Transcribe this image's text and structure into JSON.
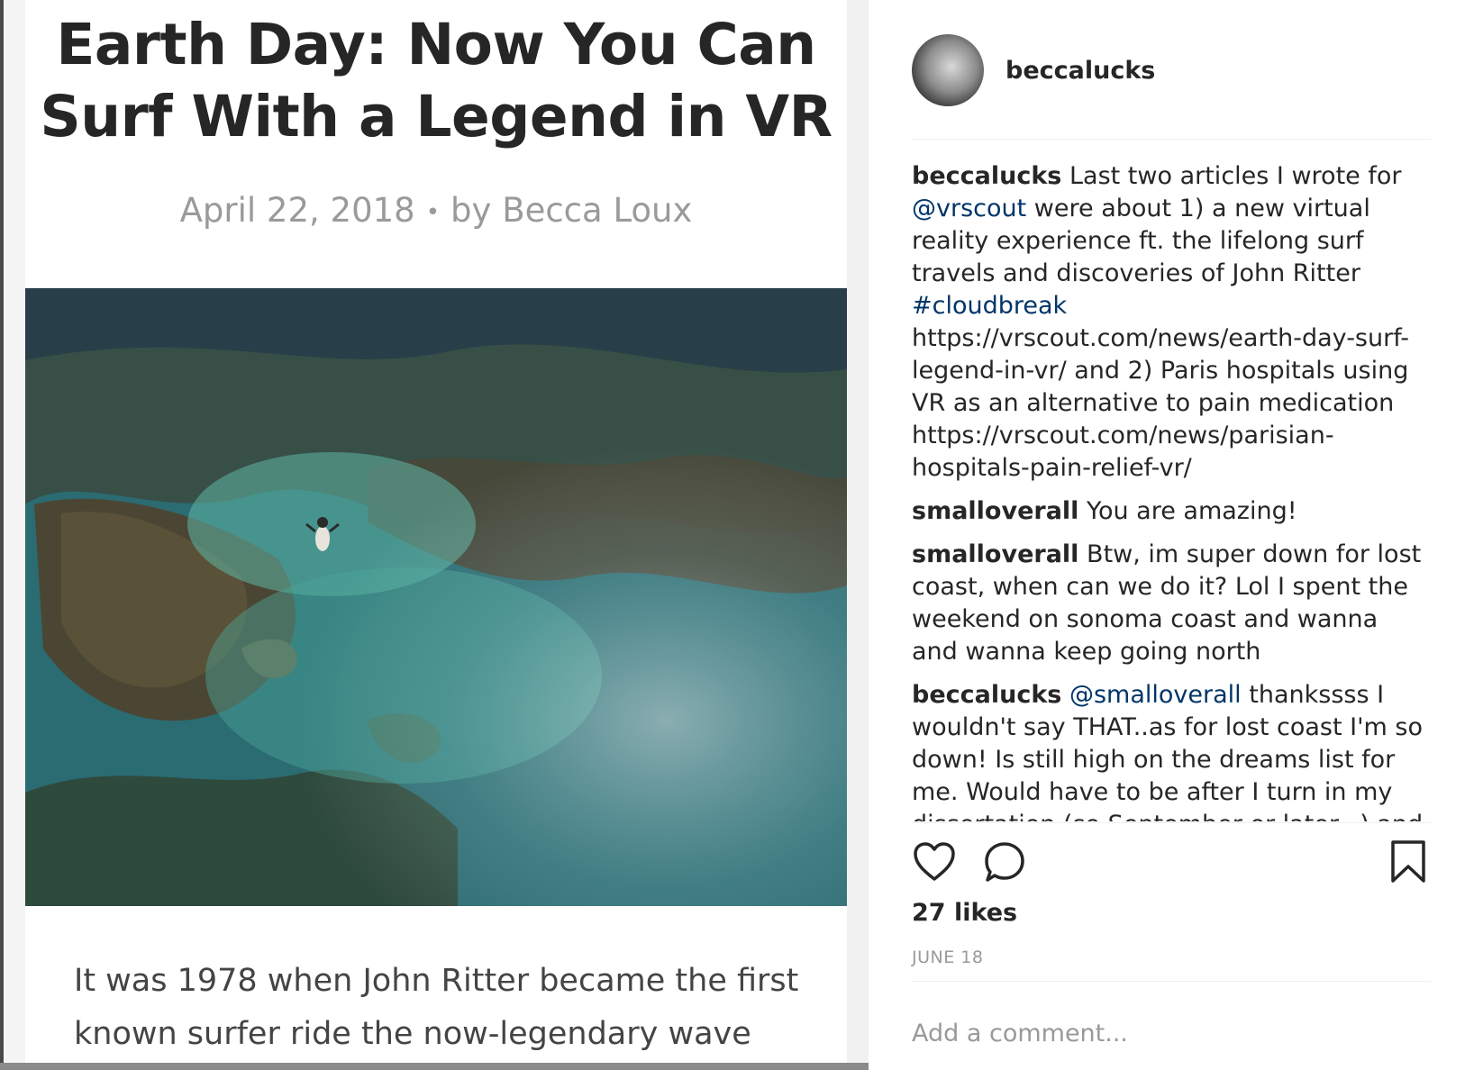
{
  "article": {
    "title": "Earth Day: Now You Can Surf With a Legend in VR",
    "date": "April 22, 2018",
    "separator": "•",
    "byline": "by Becca Loux",
    "body": "It was 1978 when John Ritter became the first known surfer ride the now-legendary wave"
  },
  "post": {
    "username": "beccalucks",
    "comments": [
      {
        "user": "beccalucks",
        "parts": [
          {
            "text": "Last two articles I wrote for "
          },
          {
            "text": "@vrscout",
            "link": true
          },
          {
            "text": " were about 1) a new virtual reality experience ft. the lifelong surf travels and discoveries of John Ritter "
          },
          {
            "text": "#cloudbreak",
            "link": true
          },
          {
            "text": " https://vrscout.com/news/earth-day-surf-legend-in-vr/ and 2) Paris hospitals using VR as an alternative to pain medication https://vrscout.com/news/parisian-hospitals-pain-relief-vr/"
          }
        ]
      },
      {
        "user": "smalloverall",
        "parts": [
          {
            "text": "You are amazing!"
          }
        ]
      },
      {
        "user": "smalloverall",
        "parts": [
          {
            "text": "Btw, im super down for lost coast, when can we do it? Lol I spent the weekend on sonoma coast and wanna and wanna keep going north"
          }
        ]
      },
      {
        "user": "beccalucks",
        "parts": [
          {
            "text": "@smalloverall",
            "link": true
          },
          {
            "text": " thankssss I wouldn't say THAT..as for lost coast I'm so down! Is still high on the dreams list for me. Would have to be after I turn in my dissertation (so September or later...) and"
          }
        ]
      }
    ],
    "likes": "27 likes",
    "date": "JUNE 18",
    "comment_placeholder": "Add a comment..."
  },
  "icons": [
    "heart-icon",
    "comment-icon",
    "bookmark-icon"
  ],
  "colors": {
    "link": "#003569",
    "text": "#262626",
    "muted": "#999999"
  }
}
